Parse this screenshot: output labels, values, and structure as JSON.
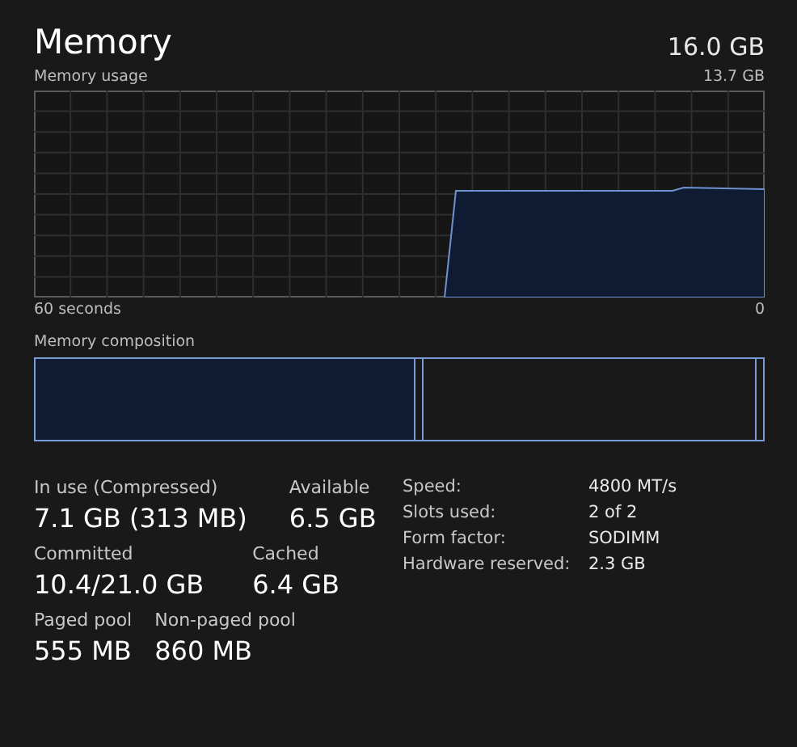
{
  "header": {
    "title": "Memory",
    "total": "16.0 GB"
  },
  "usage": {
    "label": "Memory usage",
    "max": "13.7 GB",
    "left_axis": "60 seconds",
    "right_axis": "0"
  },
  "composition": {
    "label": "Memory composition",
    "segments": [
      {
        "kind": "used"
      },
      {
        "kind": "modified"
      },
      {
        "kind": "standby"
      },
      {
        "kind": "free"
      }
    ]
  },
  "stats": [
    [
      {
        "label": "In use (Compressed)",
        "value": "7.1 GB (313 MB)"
      },
      {
        "label": "Available",
        "value": "6.5 GB"
      }
    ],
    [
      {
        "label": "Committed",
        "value": "10.4/21.0 GB"
      },
      {
        "label": "Cached",
        "value": "6.4 GB"
      }
    ],
    [
      {
        "label": "Paged pool",
        "value": "555 MB"
      },
      {
        "label": "Non-paged pool",
        "value": "860 MB"
      }
    ]
  ],
  "details": [
    {
      "key": "Speed:",
      "value": "4800 MT/s"
    },
    {
      "key": "Slots used:",
      "value": "2 of 2"
    },
    {
      "key": "Form factor:",
      "value": "SODIMM"
    },
    {
      "key": "Hardware reserved:",
      "value": "2.3 GB"
    }
  ]
}
